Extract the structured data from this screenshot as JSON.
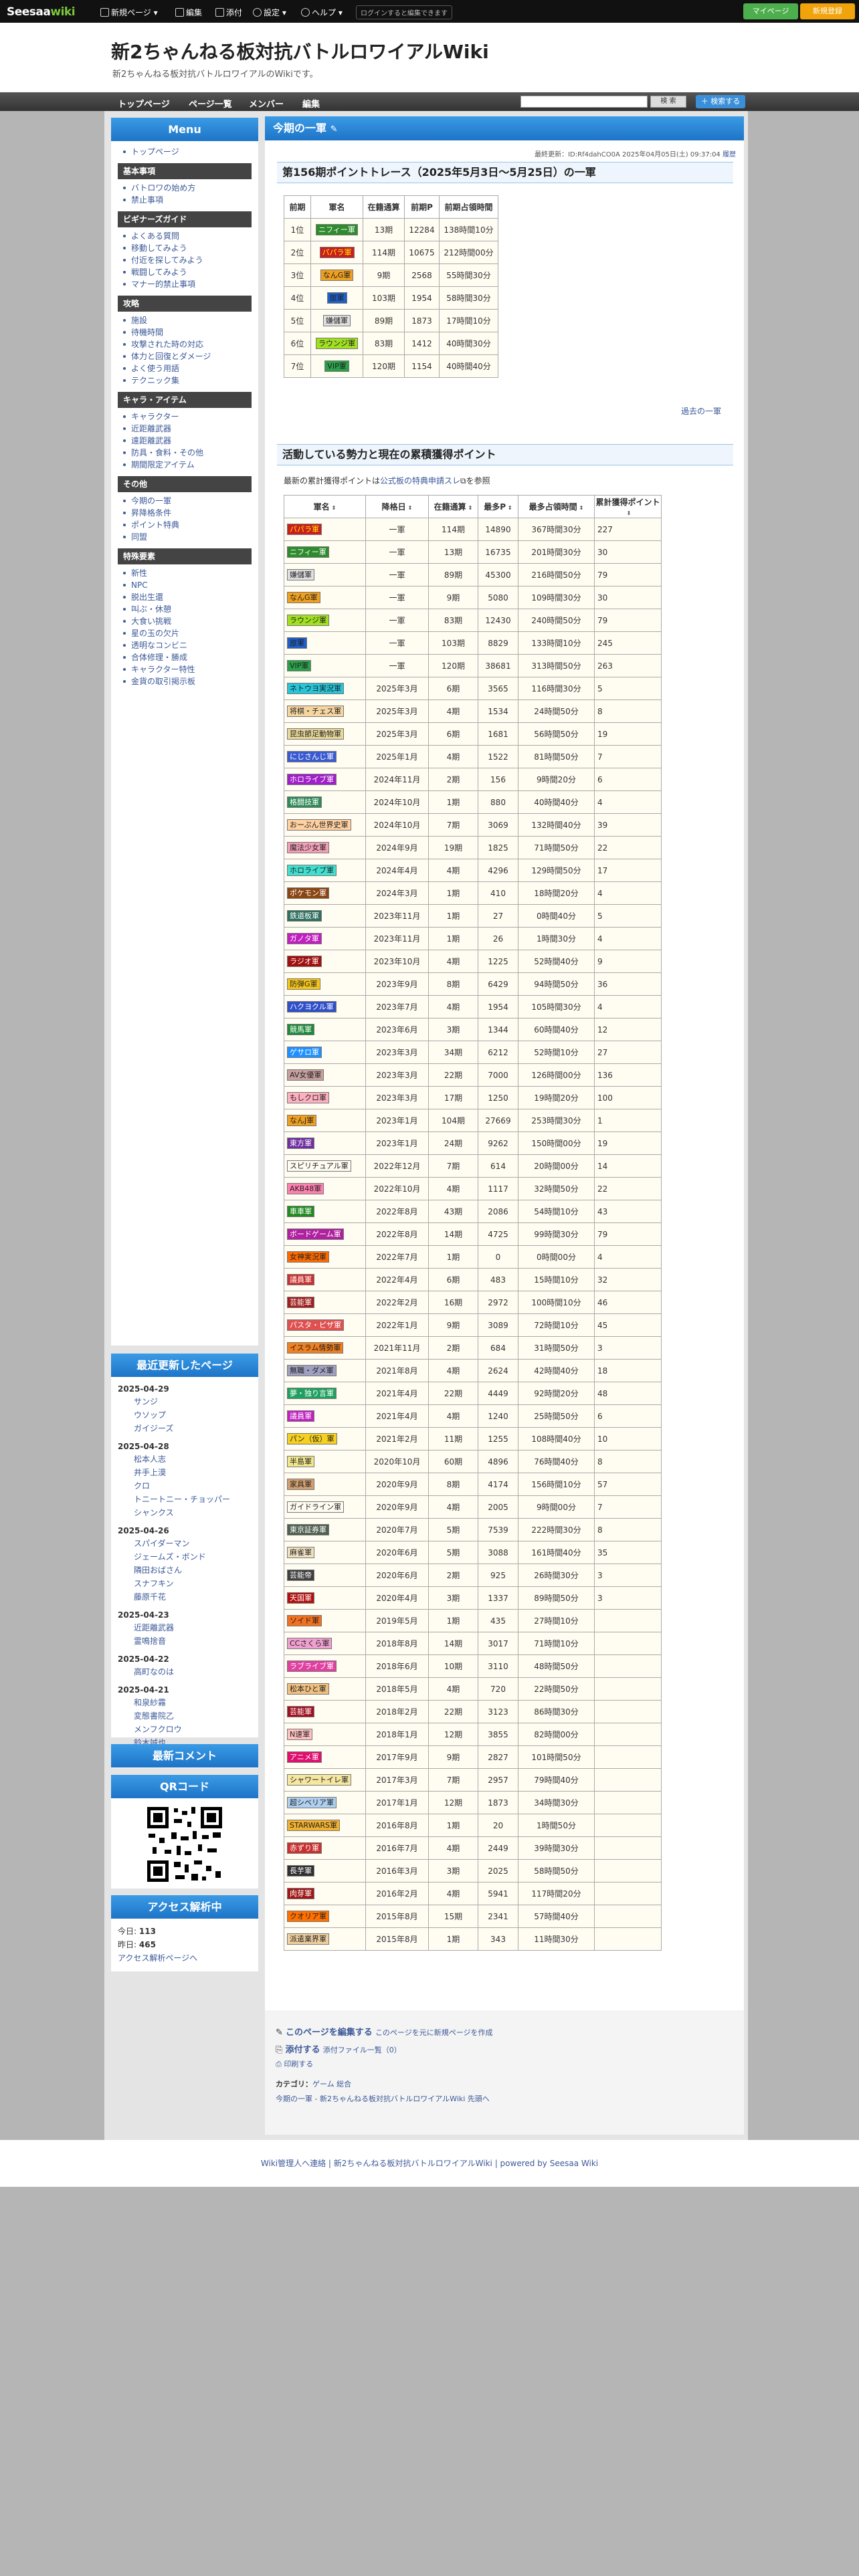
{
  "topbar": {
    "logo": "Seesaa",
    "logo_wiki": "wiki",
    "items": [
      "新規ページ",
      "編集",
      "添付",
      "設定",
      "ヘルプ"
    ],
    "hint": "ログインすると編集できます",
    "my_page": "マイページ",
    "new_register": "新規登録"
  },
  "header": {
    "title": "新2ちゃんねる板対抗バトルロワイアルWiki",
    "subtitle": "新2ちゃんねる板対抗バトルロワイアルのWikiです。"
  },
  "nav": {
    "items": [
      "トップページ",
      "ページ一覧",
      "メンバー",
      "編集"
    ],
    "search_button": "検 索",
    "plus_button": "＋ 検索する"
  },
  "sidebar": {
    "menu_title": "Menu",
    "top_link": "トップページ",
    "sections": [
      {
        "title": "基本事項",
        "links": [
          "バトロワの始め方",
          "禁止事項"
        ]
      },
      {
        "title": "ビギナーズガイド",
        "links": [
          "よくある質問",
          "移動してみよう",
          "付近を探してみよう",
          "戦闘してみよう",
          "マナー的禁止事項"
        ]
      },
      {
        "title": "攻略",
        "links": [
          "施設",
          "待機時間",
          "攻撃された時の対応",
          "体力と回復とダメージ",
          "よく使う用語",
          "テクニック集"
        ]
      },
      {
        "title": "キャラ・アイテム",
        "links": [
          "キャラクター",
          "近距離武器",
          "遠距離武器",
          "防具・食料・その他",
          "期間限定アイテム"
        ]
      },
      {
        "title": "その他",
        "links": [
          "今期の一軍",
          "昇降格条件",
          "ポイント特典",
          "同盟"
        ]
      },
      {
        "title": "特殊要素",
        "links": [
          "新性",
          "NPC",
          "脱出生還",
          "叫ぶ・休憩",
          "大食い挑戦",
          "星の玉の欠片",
          "透明なコンビニ",
          "合体修理・勝成",
          "キャラクター特性",
          "金貨の取引掲示板"
        ]
      }
    ],
    "recent_title": "最近更新したページ",
    "recent": [
      {
        "date": "2025-04-29",
        "pages": [
          "サンジ",
          "ウソップ",
          "ガイジーズ"
        ]
      },
      {
        "date": "2025-04-28",
        "pages": [
          "松本人志",
          "井手上漠",
          "クロ",
          "トニートニー・チョッパー",
          "シャンクス"
        ]
      },
      {
        "date": "2025-04-26",
        "pages": [
          "スパイダーマン",
          "ジェームズ・ボンド",
          "隣田おばさん",
          "スナフキン",
          "藤原千花"
        ]
      },
      {
        "date": "2025-04-23",
        "pages": [
          "近距離武器",
          "霊鳴捨音"
        ]
      },
      {
        "date": "2025-04-22",
        "pages": [
          "高町なのは"
        ]
      },
      {
        "date": "2025-04-21",
        "pages": [
          "和泉紗霧",
          "変態書院乙",
          "メンフクロウ",
          "鈴木誠也"
        ]
      }
    ],
    "comment_title": "最新コメント",
    "qr_title": "QRコード",
    "access_title": "アクセス解析中",
    "access_today_label": "今日:",
    "access_today": "113",
    "access_yesterday_label": "昨日:",
    "access_yesterday": "465",
    "access_link": "アクセス解析ページへ"
  },
  "main": {
    "title": "今期の一軍",
    "updated": "最終更新：ID:Rf4dahCO0A 2025年04月05日(土) 09:37:04",
    "history": "履歴",
    "trace_title": "第156期ポイントトレース（2025年5月3日〜5月25日）の一軍",
    "trace_headers": [
      "前期",
      "軍名",
      "在籍通算",
      "前期P",
      "前期占領時間"
    ],
    "trace_rows": [
      [
        "1位",
        "ニフィー軍",
        "13期",
        "12284",
        "138時間10分",
        "#2e8b2e",
        "#fff"
      ],
      [
        "2位",
        "パパラ軍",
        "114期",
        "10675",
        "212時間00分",
        "#c81e1e",
        "#ffea00"
      ],
      [
        "3位",
        "なんG軍",
        "9期",
        "2568",
        "55時間30分",
        "#f0a020",
        "#222"
      ],
      [
        "4位",
        "旅軍",
        "103期",
        "1954",
        "58時間30分",
        "#1e5fc8",
        "#222"
      ],
      [
        "5位",
        "嫌儲軍",
        "89期",
        "1873",
        "17時間10分",
        "#e0e0e0",
        "#222"
      ],
      [
        "6位",
        "ラウンジ軍",
        "83期",
        "1412",
        "40時間30分",
        "#a0e020",
        "#222"
      ],
      [
        "7位",
        "VIP軍",
        "120期",
        "1154",
        "40時間40分",
        "#2aa04a",
        "#222"
      ]
    ],
    "past_link": "過去の一軍",
    "active_title": "活動している勢力と現在の累積獲得ポイント",
    "note_pre": "最新の累計獲得ポイントは",
    "note_link": "公式板の特典申請スレ",
    "note_post": "を参照",
    "active_headers": [
      "軍名",
      "降格日",
      "在籍通算",
      "最多P",
      "最多占領時間",
      "累計獲得ポイント"
    ],
    "active_rows": [
      [
        "パパラ軍",
        "一軍",
        "114期",
        "14890",
        "367時間30分",
        "227",
        "#c81e1e",
        "#ffea00"
      ],
      [
        "ニフィー軍",
        "一軍",
        "13期",
        "16735",
        "201時間30分",
        "30",
        "#2e8b2e",
        "#fff"
      ],
      [
        "嫌儲軍",
        "一軍",
        "89期",
        "45300",
        "216時間50分",
        "79",
        "#e0e0e0",
        "#222"
      ],
      [
        "なんG軍",
        "一軍",
        "9期",
        "5080",
        "109時間30分",
        "30",
        "#f0a020",
        "#222"
      ],
      [
        "ラウンジ軍",
        "一軍",
        "83期",
        "12430",
        "240時間50分",
        "79",
        "#a0e020",
        "#222"
      ],
      [
        "旅軍",
        "一軍",
        "103期",
        "8829",
        "133時間10分",
        "245",
        "#1e5fc8",
        "#222"
      ],
      [
        "VIP軍",
        "一軍",
        "120期",
        "38681",
        "313時間50分",
        "263",
        "#2aa04a",
        "#222"
      ],
      [
        "ネトウヨ実況軍",
        "2025年3月",
        "6期",
        "3565",
        "116時間30分",
        "5",
        "#26c6da",
        "#222"
      ],
      [
        "将棋・チェス軍",
        "2025年3月",
        "4期",
        "1534",
        "24時間50分",
        "8",
        "#f5d5a0",
        "#222"
      ],
      [
        "昆虫節足動物軍",
        "2025年3月",
        "6期",
        "1681",
        "56時間50分",
        "19",
        "#e8d89a",
        "#222"
      ],
      [
        "にじさんじ軍",
        "2025年1月",
        "4期",
        "1522",
        "81時間50分",
        "7",
        "#3a5ad0",
        "#fff"
      ],
      [
        "ホロライブ軍",
        "2024年11月",
        "2期",
        "156",
        "9時間20分",
        "6",
        "#a020c8",
        "#fff"
      ],
      [
        "格闘技軍",
        "2024年10月",
        "1期",
        "880",
        "40時間40分",
        "4",
        "#2e8b57",
        "#fff"
      ],
      [
        "おーぷん世界史軍",
        "2024年10月",
        "7期",
        "3069",
        "132時間40分",
        "39",
        "#ffd0a0",
        "#222"
      ],
      [
        "魔法少女軍",
        "2024年9月",
        "19期",
        "1825",
        "71時間50分",
        "22",
        "#f4a0b8",
        "#222"
      ],
      [
        "ホロライブ軍",
        "2024年4月",
        "4期",
        "4296",
        "129時間50分",
        "17",
        "#40e0d0",
        "#222"
      ],
      [
        "ポケモン軍",
        "2024年3月",
        "1期",
        "410",
        "18時間20分",
        "4",
        "#8b4513",
        "#fff"
      ],
      [
        "鉄道板軍",
        "2023年11月",
        "1期",
        "27",
        "0時間40分",
        "5",
        "#2f6f5f",
        "#fff"
      ],
      [
        "ガノタ軍",
        "2023年11月",
        "1期",
        "26",
        "1時間30分",
        "4",
        "#c020c0",
        "#fff"
      ],
      [
        "ラジオ軍",
        "2023年10月",
        "4期",
        "1225",
        "52時間40分",
        "9",
        "#a01010",
        "#fff"
      ],
      [
        "防弾G軍",
        "2023年9月",
        "8期",
        "6429",
        "94時間50分",
        "36",
        "#f5c518",
        "#222"
      ],
      [
        "ハクヨクル軍",
        "2023年7月",
        "4期",
        "1954",
        "105時間30分",
        "4",
        "#3050c8",
        "#fff"
      ],
      [
        "競馬軍",
        "2023年6月",
        "3期",
        "1344",
        "60時間40分",
        "12",
        "#1e8a3c",
        "#fff"
      ],
      [
        "ゲサロ軍",
        "2023年3月",
        "34期",
        "6212",
        "52時間10分",
        "27",
        "#1e90ff",
        "#fff"
      ],
      [
        "AV女優軍",
        "2023年3月",
        "22期",
        "7000",
        "126時間00分",
        "136",
        "#c8a0a0",
        "#222"
      ],
      [
        "もしクロ軍",
        "2023年3月",
        "17期",
        "1250",
        "19時間20分",
        "100",
        "#ffb0c0",
        "#222"
      ],
      [
        "なんJ軍",
        "2023年1月",
        "104期",
        "27669",
        "253時間30分",
        "1",
        "#f0a020",
        "#222"
      ],
      [
        "東方軍",
        "2023年1月",
        "24期",
        "9262",
        "150時間00分",
        "19",
        "#7030a0",
        "#fff"
      ],
      [
        "スピリチュアル軍",
        "2022年12月",
        "7期",
        "614",
        "20時間00分",
        "14",
        "#fffcf2",
        "#222"
      ],
      [
        "AKB48軍",
        "2022年10月",
        "4期",
        "1117",
        "32時間50分",
        "22",
        "#ff80b0",
        "#222"
      ],
      [
        "車車軍",
        "2022年8月",
        "43期",
        "2086",
        "54時間10分",
        "43",
        "#228b22",
        "#fff"
      ],
      [
        "ボードゲーム軍",
        "2022年8月",
        "14期",
        "4725",
        "99時間30分",
        "79",
        "#b020a0",
        "#fff"
      ],
      [
        "女神実況軍",
        "2022年7月",
        "1期",
        "0",
        "0時間00分",
        "4",
        "#ff6a00",
        "#222"
      ],
      [
        "議員軍",
        "2022年4月",
        "6期",
        "483",
        "15時間10分",
        "32",
        "#c83232",
        "#fff"
      ],
      [
        "芸能軍",
        "2022年2月",
        "16期",
        "2972",
        "100時間10分",
        "46",
        "#a02020",
        "#fff"
      ],
      [
        "パスタ・ピザ軍",
        "2022年1月",
        "9期",
        "3089",
        "72時間10分",
        "45",
        "#e05050",
        "#fff"
      ],
      [
        "イスラム情勢軍",
        "2021年11月",
        "2期",
        "684",
        "31時間50分",
        "3",
        "#f08020",
        "#222"
      ],
      [
        "無職・ダメ軍",
        "2021年8月",
        "4期",
        "2624",
        "42時間40分",
        "18",
        "#a0a0c0",
        "#222"
      ],
      [
        "夢・独り言軍",
        "2021年4月",
        "22期",
        "4449",
        "92時間20分",
        "48",
        "#20a060",
        "#fff"
      ],
      [
        "議員軍",
        "2021年4月",
        "4期",
        "1240",
        "25時間50分",
        "6",
        "#c020c0",
        "#fff"
      ],
      [
        "パン（仮）軍",
        "2021年2月",
        "11期",
        "1255",
        "108時間40分",
        "10",
        "#f5d020",
        "#222"
      ],
      [
        "半島軍",
        "2020年10月",
        "60期",
        "4896",
        "76時間40分",
        "8",
        "#f0e68c",
        "#222"
      ],
      [
        "家具軍",
        "2020年9月",
        "8期",
        "4174",
        "156時間10分",
        "57",
        "#d2a070",
        "#222"
      ],
      [
        "ガイドライン軍",
        "2020年9月",
        "4期",
        "2005",
        "9時間00分",
        "7",
        "#fffcf2",
        "#222"
      ],
      [
        "東京証券軍",
        "2020年7月",
        "5期",
        "7539",
        "222時間30分",
        "8",
        "#506050",
        "#fff"
      ],
      [
        "麻雀軍",
        "2020年6月",
        "5期",
        "3088",
        "161時間40分",
        "35",
        "#f0e0c0",
        "#222"
      ],
      [
        "芸能帝",
        "2020年6月",
        "2期",
        "925",
        "26時間30分",
        "3",
        "#404040",
        "#fff"
      ],
      [
        "天国軍",
        "2020年4月",
        "3期",
        "1337",
        "89時間50分",
        "3",
        "#b01010",
        "#fff"
      ],
      [
        "ソイド軍",
        "2019年5月",
        "1期",
        "435",
        "27時間10分",
        "",
        "#f07020",
        "#222"
      ],
      [
        "CCさくら軍",
        "2018年8月",
        "14期",
        "3017",
        "71時間10分",
        "",
        "#f0a0d0",
        "#222"
      ],
      [
        "ラブライブ軍",
        "2018年6月",
        "10期",
        "3110",
        "48時間50分",
        "",
        "#e040a0",
        "#fff"
      ],
      [
        "松本ひと軍",
        "2018年5月",
        "4期",
        "720",
        "22時間50分",
        "",
        "#f0c080",
        "#222"
      ],
      [
        "芸能軍",
        "2018年2月",
        "22期",
        "3123",
        "86時間30分",
        "",
        "#a01020",
        "#fff"
      ],
      [
        "N速軍",
        "2018年1月",
        "12期",
        "3855",
        "82時間00分",
        "",
        "#ffc0c0",
        "#222"
      ],
      [
        "アニメ軍",
        "2017年9月",
        "9期",
        "2827",
        "101時間50分",
        "",
        "#e01070",
        "#fff"
      ],
      [
        "シャワートイレ軍",
        "2017年3月",
        "7期",
        "2957",
        "79時間40分",
        "",
        "#f5e6a0",
        "#222"
      ],
      [
        "超シベリア軍",
        "2017年1月",
        "12期",
        "1873",
        "34時間30分",
        "",
        "#b0d0f0",
        "#222"
      ],
      [
        "STARWARS軍",
        "2016年8月",
        "1期",
        "20",
        "1時間50分",
        "",
        "#f0b030",
        "#222"
      ],
      [
        "赤ずり軍",
        "2016年7月",
        "4期",
        "2449",
        "39時間30分",
        "",
        "#c83030",
        "#fff"
      ],
      [
        "長芋軍",
        "2016年3月",
        "3期",
        "2025",
        "58時間50分",
        "",
        "#303030",
        "#fff"
      ],
      [
        "肉芽軍",
        "2016年2月",
        "4期",
        "5941",
        "117時間20分",
        "",
        "#a01818",
        "#fff"
      ],
      [
        "クオリア軍",
        "2015年8月",
        "15期",
        "2341",
        "57時間40分",
        "",
        "#ff7000",
        "#222"
      ],
      [
        "派遣業界軍",
        "2015年8月",
        "1期",
        "343",
        "11時間30分",
        "",
        "#f0d0a0",
        "#222"
      ]
    ],
    "edit_link": "このページを編集する",
    "edit_sub": "このページを元に新規ページを作成",
    "attach_link": "添付する",
    "attach_sub": "添付ファイル一覧（0）",
    "print": "印刷する",
    "category_label": "カテゴリ：",
    "categories": "ゲーム 総合",
    "breadcrumb": "今期の一軍 - 新2ちゃんねる板対抗バトルロワイアルWiki 先頭へ"
  },
  "footer": {
    "text": "Wiki管理人へ連絡 | 新2ちゃんねる板対抗バトルロワイアルWiki | powered by Seesaa Wiki"
  }
}
